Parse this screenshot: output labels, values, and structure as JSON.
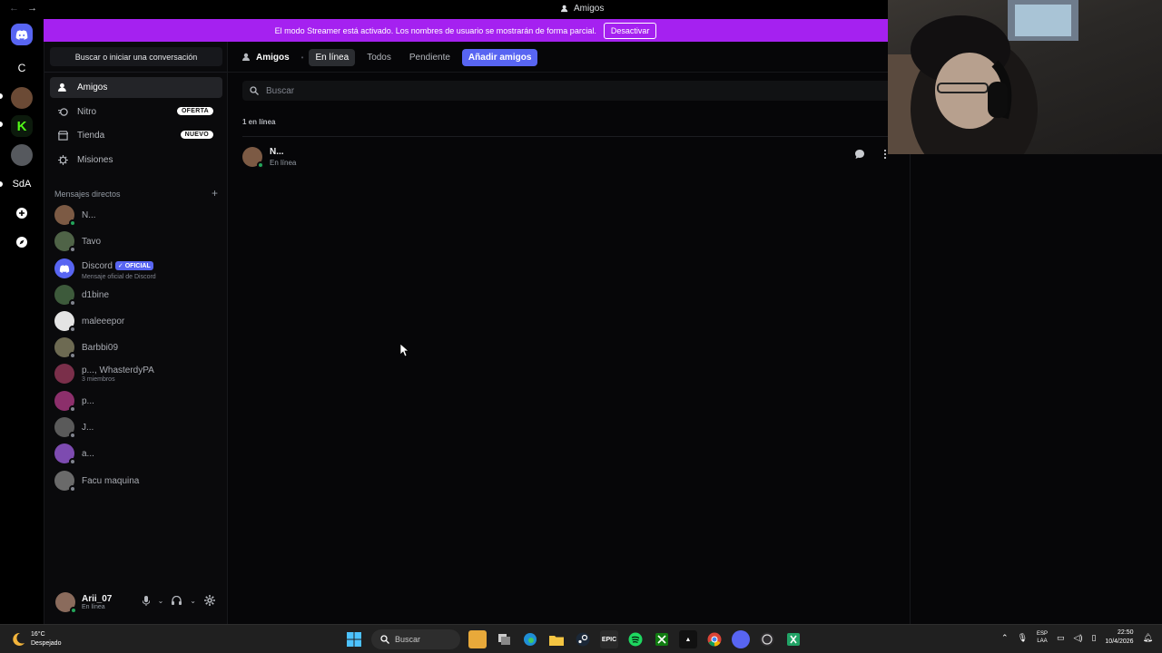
{
  "window": {
    "title": "Amigos",
    "back": "←",
    "forward": "→"
  },
  "rail": {
    "servers": [
      {
        "label": "C"
      },
      {
        "label": "SdA"
      }
    ]
  },
  "banner": {
    "text": "El modo Streamer está activado. Los nombres de usuario se mostrarán de forma parcial.",
    "button": "Desactivar"
  },
  "sidebar": {
    "search": "Buscar o iniciar una conversación",
    "nav": [
      {
        "label": "Amigos"
      },
      {
        "label": "Nitro",
        "badge": "OFERTA"
      },
      {
        "label": "Tienda",
        "badge": "NUEVO"
      },
      {
        "label": "Misiones"
      }
    ],
    "dm_header": "Mensajes directos",
    "dm_add": "+",
    "dms": [
      {
        "name": "N...",
        "sub": ""
      },
      {
        "name": "Tavo",
        "sub": ""
      },
      {
        "name": "Discord",
        "badge": "OFICIAL",
        "sub": "Mensaje oficial de Discord"
      },
      {
        "name": "d1bine",
        "sub": ""
      },
      {
        "name": "maleeepor",
        "sub": ""
      },
      {
        "name": "Barbbi09",
        "sub": ""
      },
      {
        "name": "p..., WhasterdyPA",
        "sub": "3 miembros"
      },
      {
        "name": "p...",
        "sub": ""
      },
      {
        "name": "J...",
        "sub": ""
      },
      {
        "name": "a...",
        "sub": ""
      },
      {
        "name": "Facu maquina",
        "sub": ""
      }
    ]
  },
  "user": {
    "name": "Arii_07",
    "status": "En línea"
  },
  "main": {
    "tabs": {
      "title": "Amigos",
      "online": "En línea",
      "all": "Todos",
      "pending": "Pendiente",
      "add": "Añadir amigos"
    },
    "search_placeholder": "Buscar",
    "count": "1 en línea",
    "friends": [
      {
        "name": "N...",
        "status": "En línea"
      }
    ]
  },
  "taskbar": {
    "weather_temp": "16°C",
    "weather_desc": "Despejado",
    "search": "Buscar",
    "lang": "ESP",
    "lang2": "LAA",
    "time": "22:50",
    "date": "10/4/2026"
  },
  "colors": {
    "blurple": "#5865f2",
    "streamer": "#a521f0",
    "online": "#23a55a"
  }
}
